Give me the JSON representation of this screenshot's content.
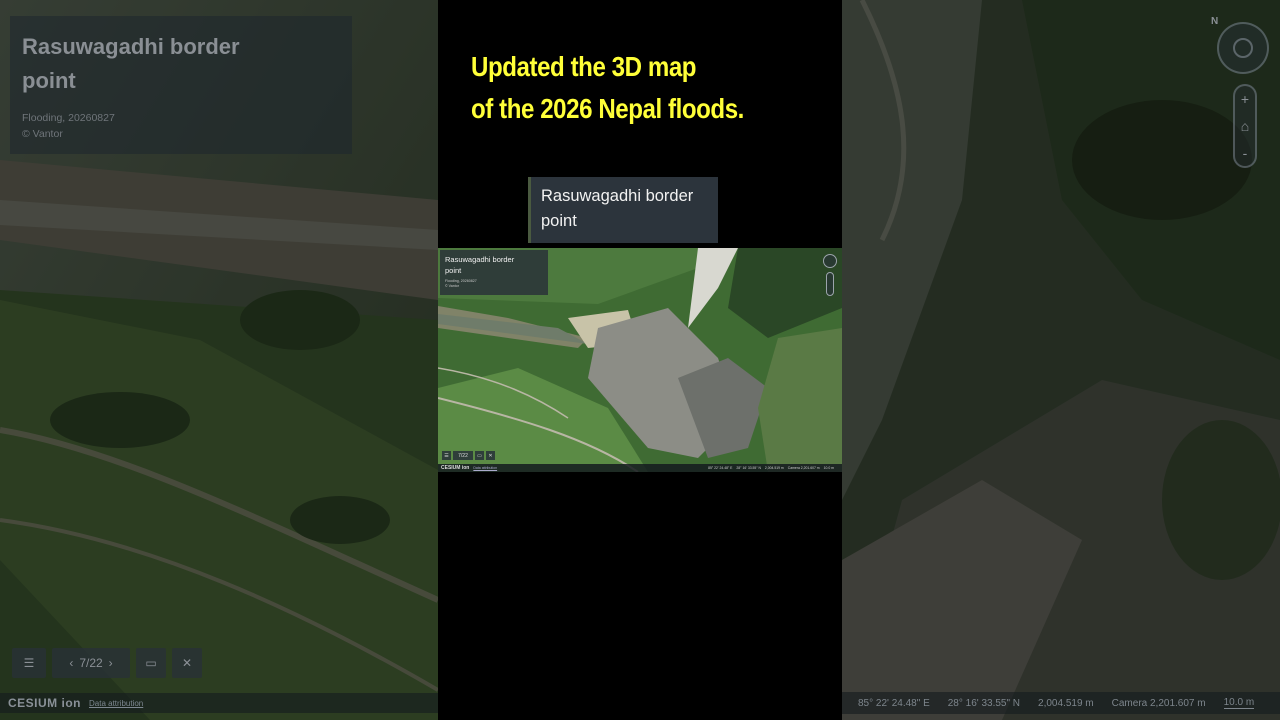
{
  "headline": {
    "line1": "Updated the 3D map",
    "line2": "of the 2026 Nepal floods."
  },
  "story": {
    "title": "Rasuwagadhi border point",
    "subtitle": "Flooding, 20260827",
    "credit": "© Vantor"
  },
  "zoom_card": {
    "title": "Rasuwagadhi border point"
  },
  "navigation": {
    "list_icon": "list-icon",
    "prev_icon": "chevron-left-icon",
    "page": "7/22",
    "next_icon": "chevron-right-icon",
    "present_icon": "monitor-icon",
    "close_icon": "close-icon"
  },
  "footer": {
    "logo": "CESIUM ion",
    "attribution": "Data attribution"
  },
  "status_bar": {
    "longitude": "85° 22' 24.48\" E",
    "latitude": "28° 16' 33.55\" N",
    "elevation": "2,004.519 m",
    "camera": "Camera 2,201.607 m",
    "scale": "10.0 m"
  },
  "map_controls": {
    "compass_label": "N",
    "zoom_in": "+",
    "zoom_out": "-"
  },
  "colors": {
    "headline": "#ffff38",
    "card_bg": "#2c343c",
    "page_bg": "#000000"
  }
}
